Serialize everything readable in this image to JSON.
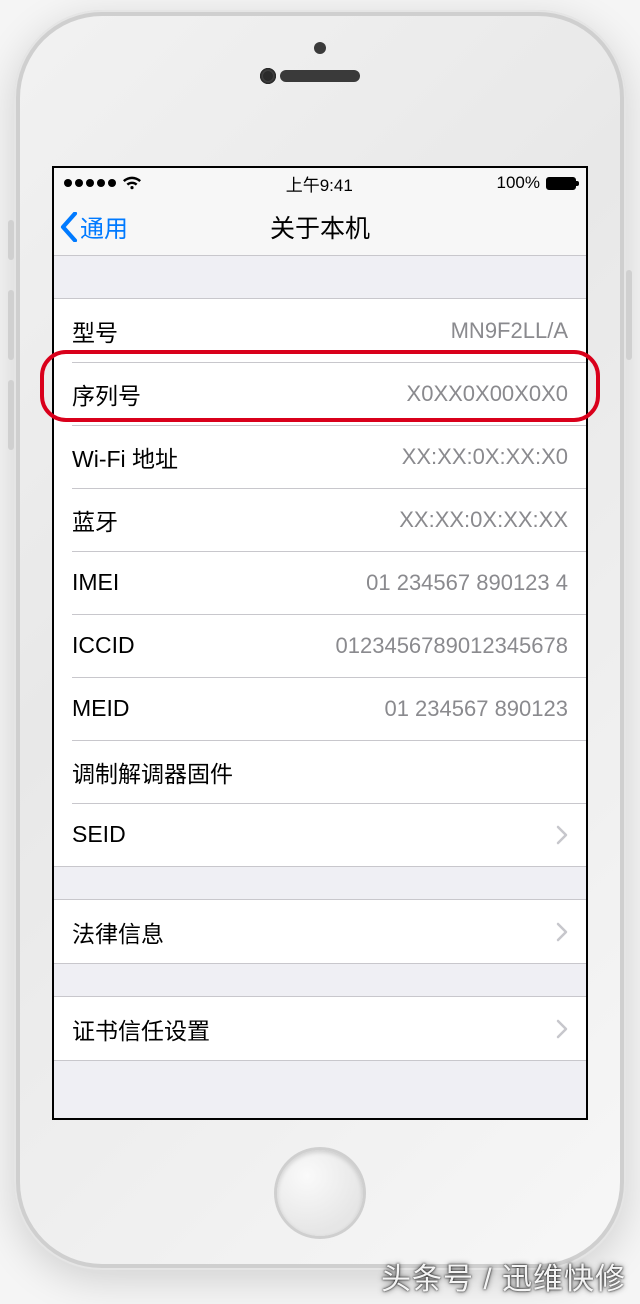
{
  "status": {
    "time": "上午9:41",
    "battery_text": "100%"
  },
  "nav": {
    "back_label": "通用",
    "title": "关于本机"
  },
  "rows": {
    "model": {
      "label": "型号",
      "value": "MN9F2LL/A"
    },
    "serial": {
      "label": "序列号",
      "value": "X0XX0X00X0X0"
    },
    "wifi": {
      "label": "Wi-Fi 地址",
      "value": "XX:XX:0X:XX:X0"
    },
    "bluetooth": {
      "label": "蓝牙",
      "value": "XX:XX:0X:XX:XX"
    },
    "imei": {
      "label": "IMEI",
      "value": "01 234567 890123 4"
    },
    "iccid": {
      "label": "ICCID",
      "value": "01234567890123456​78"
    },
    "meid": {
      "label": "MEID",
      "value": "01 234567 890123"
    },
    "modem": {
      "label": "调制解调器固件",
      "value": ""
    },
    "seid": {
      "label": "SEID",
      "value": ""
    },
    "legal": {
      "label": "法律信息",
      "value": ""
    },
    "cert": {
      "label": "证书信任设置",
      "value": ""
    }
  },
  "watermark": "头条号 / 迅维快修"
}
